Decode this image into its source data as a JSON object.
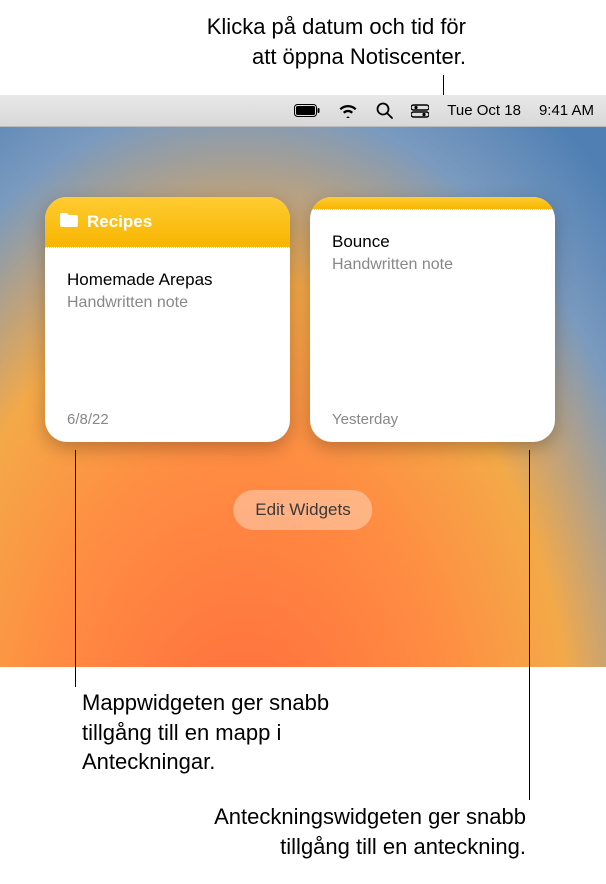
{
  "callouts": {
    "top_line1": "Klicka på datum och tid för",
    "top_line2": "att öppna Notiscenter.",
    "left_line1": "Mappwidgeten ger snabb",
    "left_line2": "tillgång till en mapp i",
    "left_line3": "Anteckningar.",
    "right_line1": "Anteckningswidgeten ger snabb",
    "right_line2": "tillgång till en anteckning."
  },
  "menubar": {
    "date": "Tue Oct 18",
    "time": "9:41 AM"
  },
  "widgets": {
    "folder": {
      "header_title": "Recipes",
      "note_title": "Homemade Arepas",
      "note_subtitle": "Handwritten note",
      "date": "6/8/22"
    },
    "note": {
      "note_title": "Bounce",
      "note_subtitle": "Handwritten note",
      "date": "Yesterday"
    }
  },
  "edit_widgets_label": "Edit Widgets"
}
